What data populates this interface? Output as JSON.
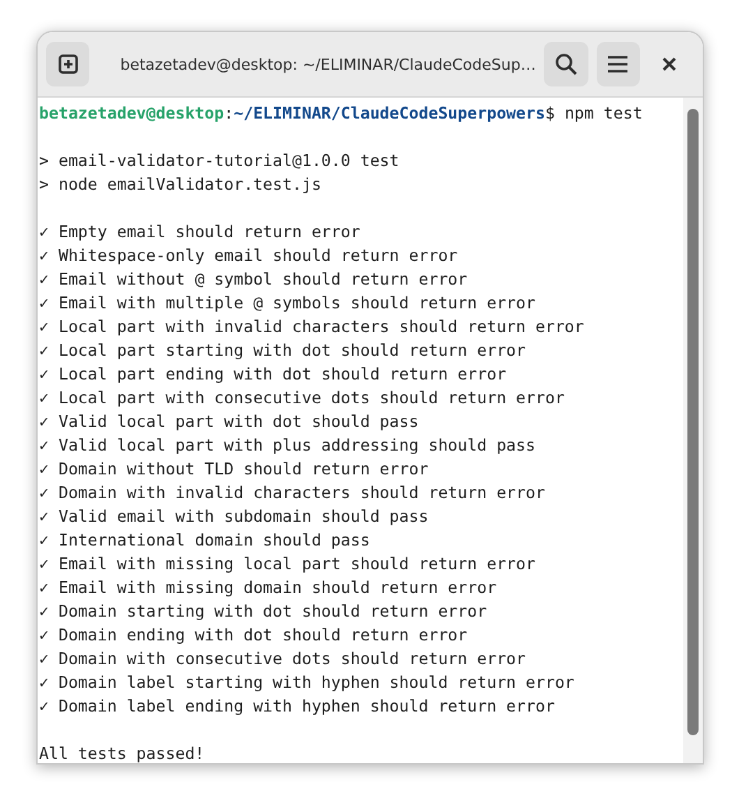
{
  "window": {
    "title": "betazetadev@desktop: ~/ELIMINAR/ClaudeCodeSup…"
  },
  "prompt": {
    "user_host": "betazetadev@desktop",
    "separator": ":",
    "path": "~/ELIMINAR/ClaudeCodeSuperpowers",
    "symbol": "$",
    "command": "npm test"
  },
  "output": [
    {
      "kind": "blank"
    },
    {
      "kind": "text",
      "text": "> email-validator-tutorial@1.0.0 test"
    },
    {
      "kind": "text",
      "text": "> node emailValidator.test.js"
    },
    {
      "kind": "blank"
    },
    {
      "kind": "check",
      "mark": "✓",
      "text": "Empty email should return error"
    },
    {
      "kind": "check",
      "mark": "✓",
      "text": "Whitespace-only email should return error"
    },
    {
      "kind": "check",
      "mark": "✓",
      "text": "Email without @ symbol should return error"
    },
    {
      "kind": "check",
      "mark": "✓",
      "text": "Email with multiple @ symbols should return error"
    },
    {
      "kind": "check",
      "mark": "✓",
      "text": "Local part with invalid characters should return error"
    },
    {
      "kind": "check",
      "mark": "✓",
      "text": "Local part starting with dot should return error"
    },
    {
      "kind": "check",
      "mark": "✓",
      "text": "Local part ending with dot should return error"
    },
    {
      "kind": "check",
      "mark": "✓",
      "text": "Local part with consecutive dots should return error"
    },
    {
      "kind": "check",
      "mark": "✓",
      "text": "Valid local part with dot should pass"
    },
    {
      "kind": "check",
      "mark": "✓",
      "text": "Valid local part with plus addressing should pass"
    },
    {
      "kind": "check",
      "mark": "✓",
      "text": "Domain without TLD should return error"
    },
    {
      "kind": "check",
      "mark": "✓",
      "text": "Domain with invalid characters should return error"
    },
    {
      "kind": "check",
      "mark": "✓",
      "text": "Valid email with subdomain should pass"
    },
    {
      "kind": "check",
      "mark": "✓",
      "text": "International domain should pass"
    },
    {
      "kind": "check",
      "mark": "✓",
      "text": "Email with missing local part should return error"
    },
    {
      "kind": "check",
      "mark": "✓",
      "text": "Email with missing domain should return error"
    },
    {
      "kind": "check",
      "mark": "✓",
      "text": "Domain starting with dot should return error"
    },
    {
      "kind": "check",
      "mark": "✓",
      "text": "Domain ending with dot should return error"
    },
    {
      "kind": "check",
      "mark": "✓",
      "text": "Domain with consecutive dots should return error"
    },
    {
      "kind": "check",
      "mark": "✓",
      "text": "Domain label starting with hyphen should return error"
    },
    {
      "kind": "check",
      "mark": "✓",
      "text": "Domain label ending with hyphen should return error"
    },
    {
      "kind": "blank"
    },
    {
      "kind": "text",
      "text": "All tests passed!"
    }
  ]
}
